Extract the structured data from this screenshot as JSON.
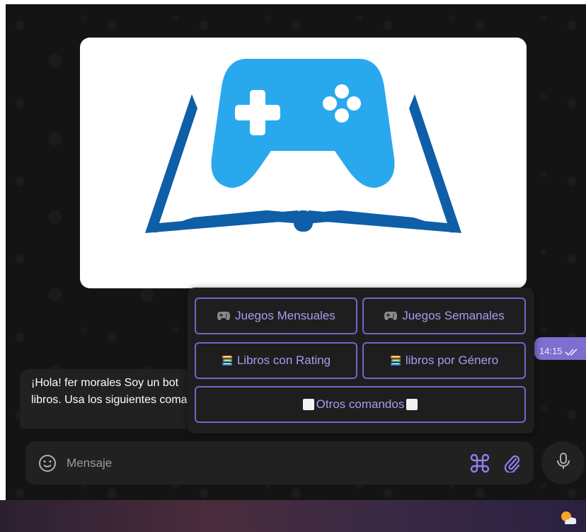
{
  "colors": {
    "accent": "#7f6ecf",
    "button_border": "#7564c9",
    "button_text": "#a99af0",
    "chat_bg": "#141414",
    "panel_bg": "#212121",
    "logo_light_blue": "#29a8ee",
    "logo_dark_blue": "#0f5ea8"
  },
  "sent_message": {
    "time": "14:15",
    "status_icon": "double-check-icon"
  },
  "received_message": {
    "lines": [
      "¡Hola! fer morales Soy un bot",
      "libros. Usa los siguientes comandos"
    ]
  },
  "keyboard": {
    "buttons": [
      {
        "label": "Juegos Mensuales",
        "icon": "gamepad-icon"
      },
      {
        "label": "Juegos Semanales",
        "icon": "gamepad-icon"
      },
      {
        "label": "Libros con Rating",
        "icon": "books-icon"
      },
      {
        "label": "libros por Género",
        "icon": "books-icon"
      },
      {
        "label": "Otros comandos",
        "icon": "white-square-icon"
      }
    ]
  },
  "input": {
    "placeholder": "Mensaje",
    "value": ""
  },
  "icons": {
    "emoji": "emoji-icon",
    "commands": "command-icon",
    "attach": "paperclip-icon",
    "voice": "microphone-icon",
    "weather": "weather-icon"
  }
}
